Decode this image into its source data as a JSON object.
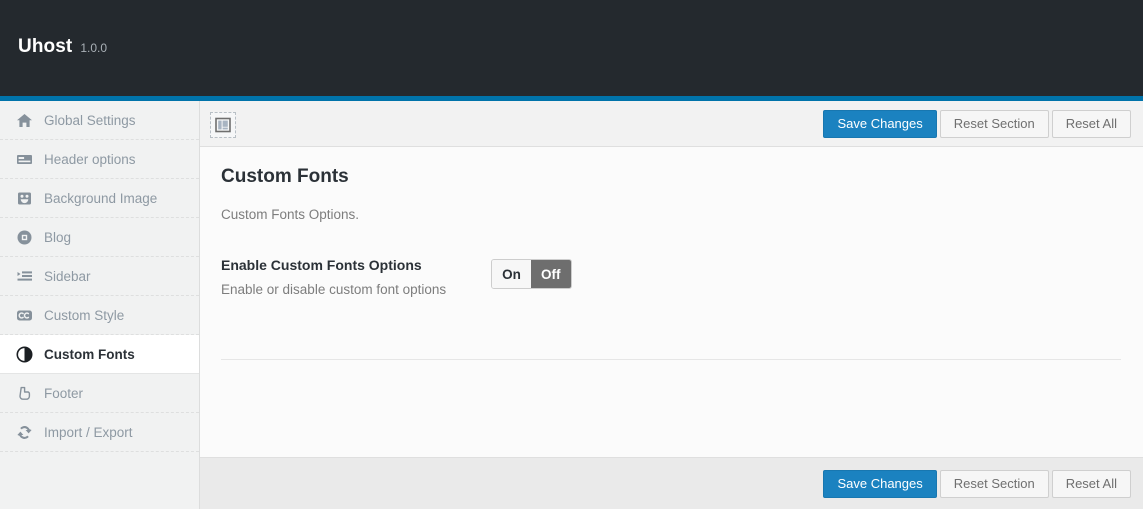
{
  "header": {
    "brand": "Uhost",
    "version": "1.0.0",
    "background_color": "#24292e",
    "accent_color": "#0073aa"
  },
  "sidebar": {
    "items": [
      {
        "label": "Global Settings",
        "icon": "home-icon",
        "active": false
      },
      {
        "label": "Header options",
        "icon": "header-bar-icon",
        "active": false
      },
      {
        "label": "Background Image",
        "icon": "smiley-image-icon",
        "active": false
      },
      {
        "label": "Blog",
        "icon": "circle-square-icon",
        "active": false
      },
      {
        "label": "Sidebar",
        "icon": "indent-list-icon",
        "active": false
      },
      {
        "label": "Custom Style",
        "icon": "cc-badge-icon",
        "active": false
      },
      {
        "label": "Custom Fonts",
        "icon": "contrast-circle-icon",
        "active": true
      },
      {
        "label": "Footer",
        "icon": "pointing-hand-icon",
        "active": false
      },
      {
        "label": "Import / Export",
        "icon": "sync-arrows-icon",
        "active": false
      }
    ]
  },
  "toolbar": {
    "layout_toggle_icon": "expand-layout-icon",
    "save_label": "Save Changes",
    "reset_section_label": "Reset Section",
    "reset_all_label": "Reset All",
    "primary_color": "#1b82c0"
  },
  "content": {
    "title": "Custom Fonts",
    "subtitle": "Custom Fonts Options.",
    "fields": [
      {
        "title": "Enable Custom Fonts Options",
        "description": "Enable or disable custom font options",
        "control": "on-off-switch",
        "on_label": "On",
        "off_label": "Off",
        "value": "Off"
      }
    ]
  },
  "footer_toolbar": {
    "save_label": "Save Changes",
    "reset_section_label": "Reset Section",
    "reset_all_label": "Reset All"
  }
}
